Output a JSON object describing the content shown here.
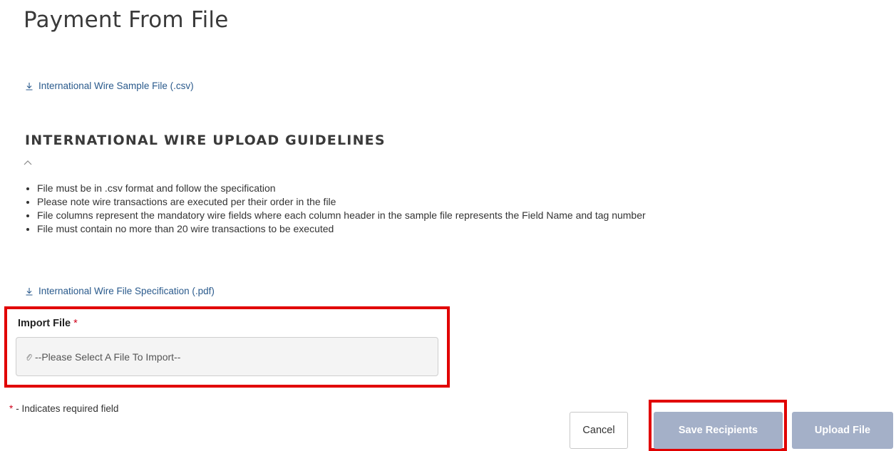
{
  "page": {
    "title": "Payment From File"
  },
  "links": {
    "sample_file": "International Wire Sample File (.csv)",
    "specification": "International Wire File Specification (.pdf)"
  },
  "guidelines": {
    "title": "INTERNATIONAL WIRE UPLOAD GUIDELINES",
    "items": [
      "File must be in .csv format and follow the specification",
      "Please note wire transactions are executed per their order in the file",
      "File columns represent the mandatory wire fields where each column header in the sample file represents the Field Name and tag number",
      "File must contain no more than 20 wire transactions to be executed"
    ]
  },
  "import_file": {
    "label": "Import File",
    "required_marker": "*",
    "placeholder": "--Please Select A File To Import--"
  },
  "required_note": {
    "marker": "*",
    "text": "- Indicates required field"
  },
  "buttons": {
    "cancel": "Cancel",
    "save_recipients": "Save Recipients",
    "upload_file": "Upload File"
  },
  "colors": {
    "link": "#2a5a8c",
    "highlight": "#e10000",
    "required": "#d0021b",
    "disabled_button": "#a4b0c8"
  },
  "icons": {
    "download": "download-icon",
    "collapse": "chevron-up-icon",
    "attachment": "paperclip-icon"
  }
}
